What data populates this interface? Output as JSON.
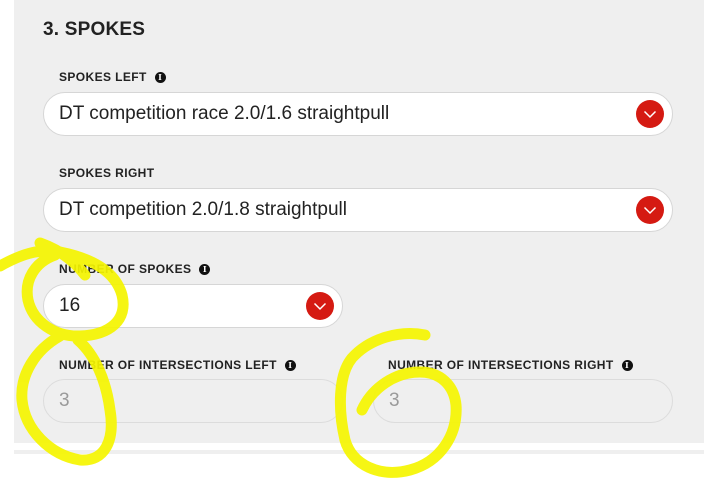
{
  "section": {
    "title": "3. SPOKES"
  },
  "fields": {
    "spokes_left": {
      "label": "SPOKES LEFT",
      "value": "DT competition race 2.0/1.6 straightpull"
    },
    "spokes_right": {
      "label": "SPOKES RIGHT",
      "value": "DT competition 2.0/1.8 straightpull"
    },
    "number_of_spokes": {
      "label": "NUMBER OF SPOKES",
      "value": "16"
    },
    "intersections_left": {
      "label": "NUMBER OF INTERSECTIONS LEFT",
      "value": "3"
    },
    "intersections_right": {
      "label": "NUMBER OF INTERSECTIONS RIGHT",
      "value": "3"
    }
  },
  "icons": {
    "info": "info-icon",
    "dropdown": "chevron-down-icon"
  },
  "colors": {
    "accent": "#d51a12",
    "panel": "#efefef",
    "highlight": "#f5f500"
  }
}
